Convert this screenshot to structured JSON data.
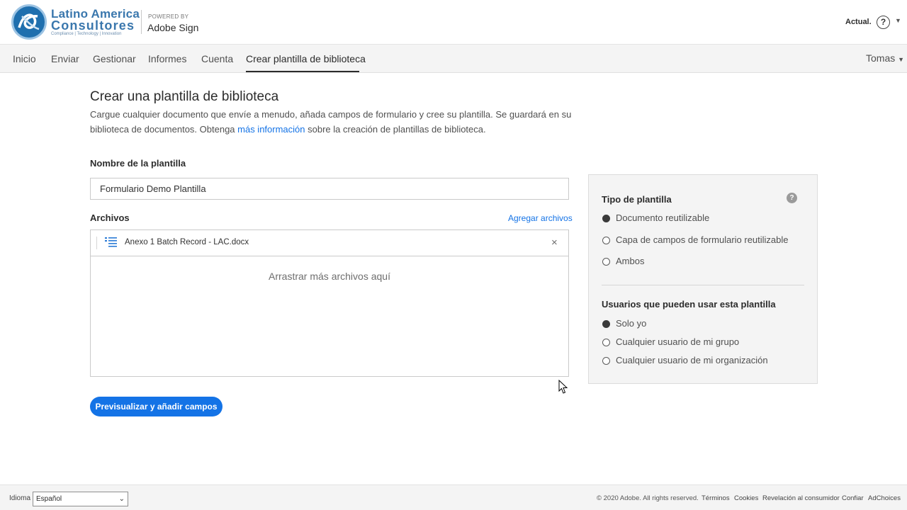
{
  "header": {
    "logo_line1": "Latino America",
    "logo_line2": "Consultores",
    "logo_line3": "Compliance | Technology | Innovation",
    "powered_by": "POWERED BY",
    "product": "Adobe Sign",
    "upgrade_label": "Actual.",
    "help_label": "?"
  },
  "nav": {
    "items": [
      "Inicio",
      "Enviar",
      "Gestionar",
      "Informes",
      "Cuenta",
      "Crear plantilla de biblioteca"
    ],
    "active_index": 5,
    "user": "Tomas"
  },
  "main": {
    "title": "Crear una plantilla de biblioteca",
    "desc_part1": "Cargue cualquier documento que envíe a menudo, añada campos de formulario y cree su plantilla. Se guardará en su biblioteca de documentos. Obtenga ",
    "desc_link": "más información",
    "desc_part2": " sobre la creación de plantillas de biblioteca.",
    "template_name_label": "Nombre de la plantilla",
    "template_name_value": "Formulario Demo Plantilla",
    "files_label": "Archivos",
    "add_files_label": "Agregar archivos",
    "files": [
      {
        "name": "Anexo 1 Batch Record - LAC.docx",
        "icon": "document-icon"
      }
    ],
    "remove_label": "×",
    "drop_hint": "Arrastrar más archivos aquí",
    "preview_button": "Previsualizar y añadir campos"
  },
  "panel": {
    "type_heading": "Tipo de plantilla",
    "help_label": "?",
    "type_options": [
      {
        "label": "Documento reutilizable",
        "checked": true
      },
      {
        "label": "Capa de campos de formulario reutilizable",
        "checked": false
      },
      {
        "label": "Ambos",
        "checked": false
      }
    ],
    "users_heading": "Usuarios que pueden usar esta plantilla",
    "user_options": [
      {
        "label": "Solo yo",
        "checked": true
      },
      {
        "label": "Cualquier usuario de mi grupo",
        "checked": false
      },
      {
        "label": "Cualquier usuario de mi organización",
        "checked": false
      }
    ]
  },
  "footer": {
    "language_label": "Idioma",
    "language_value": "Español",
    "copyright": "© 2020 Adobe. All rights reserved.",
    "links": [
      "Términos",
      "Cookies",
      "Revelación al consumidor",
      "Confiar",
      "AdChoices"
    ]
  },
  "colors": {
    "accent": "#1473e6",
    "nav_bg": "#f4f4f4",
    "panel_bg": "#f4f4f4",
    "logo_blue": "#3a77ad"
  }
}
